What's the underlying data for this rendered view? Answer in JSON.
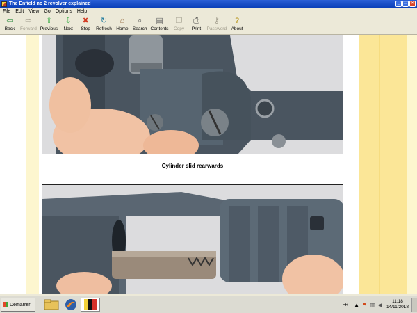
{
  "window": {
    "title": "The Enfield no 2 revolver explained"
  },
  "menu": [
    "File",
    "Edit",
    "View",
    "Go",
    "Options",
    "Help"
  ],
  "toolbar": [
    {
      "label": "Back",
      "icon": "back-arrow-icon",
      "glyph": "⇦",
      "color": "#2b8a3e",
      "enabled": true
    },
    {
      "label": "Forward",
      "icon": "forward-arrow-icon",
      "glyph": "⇨",
      "color": "#a09c8c",
      "enabled": false
    },
    {
      "label": "Previous",
      "icon": "previous-arrow-icon",
      "glyph": "⇧",
      "color": "#2aa63a",
      "enabled": true
    },
    {
      "label": "Next",
      "icon": "next-arrow-icon",
      "glyph": "⇩",
      "color": "#2aa63a",
      "enabled": true
    },
    {
      "label": "Stop",
      "icon": "stop-icon",
      "glyph": "✖",
      "color": "#d23a22",
      "enabled": true
    },
    {
      "label": "Refresh",
      "icon": "refresh-icon",
      "glyph": "↻",
      "color": "#1f7a9e",
      "enabled": true
    },
    {
      "label": "Home",
      "icon": "home-icon",
      "glyph": "⌂",
      "color": "#8a5a2a",
      "enabled": true
    },
    {
      "label": "Search",
      "icon": "search-icon",
      "glyph": "⌕",
      "color": "#555555",
      "enabled": true
    },
    {
      "label": "Contents",
      "icon": "contents-icon",
      "glyph": "▤",
      "color": "#666666",
      "enabled": true
    },
    {
      "label": "Copy",
      "icon": "copy-icon",
      "glyph": "❐",
      "color": "#a09c8c",
      "enabled": false
    },
    {
      "label": "Print",
      "icon": "print-icon",
      "glyph": "⎙",
      "color": "#444444",
      "enabled": true
    },
    {
      "label": "Password",
      "icon": "key-icon",
      "glyph": "⚷",
      "color": "#a09c8c",
      "enabled": false
    },
    {
      "label": "About",
      "icon": "about-icon",
      "glyph": "?",
      "color": "#b08a00",
      "enabled": true
    }
  ],
  "content": {
    "caption": "Cylinder slid rearwards"
  },
  "taskbar": {
    "start_label": "Démarrer",
    "language": "FR",
    "time": "11:18",
    "date": "14/11/2018"
  }
}
